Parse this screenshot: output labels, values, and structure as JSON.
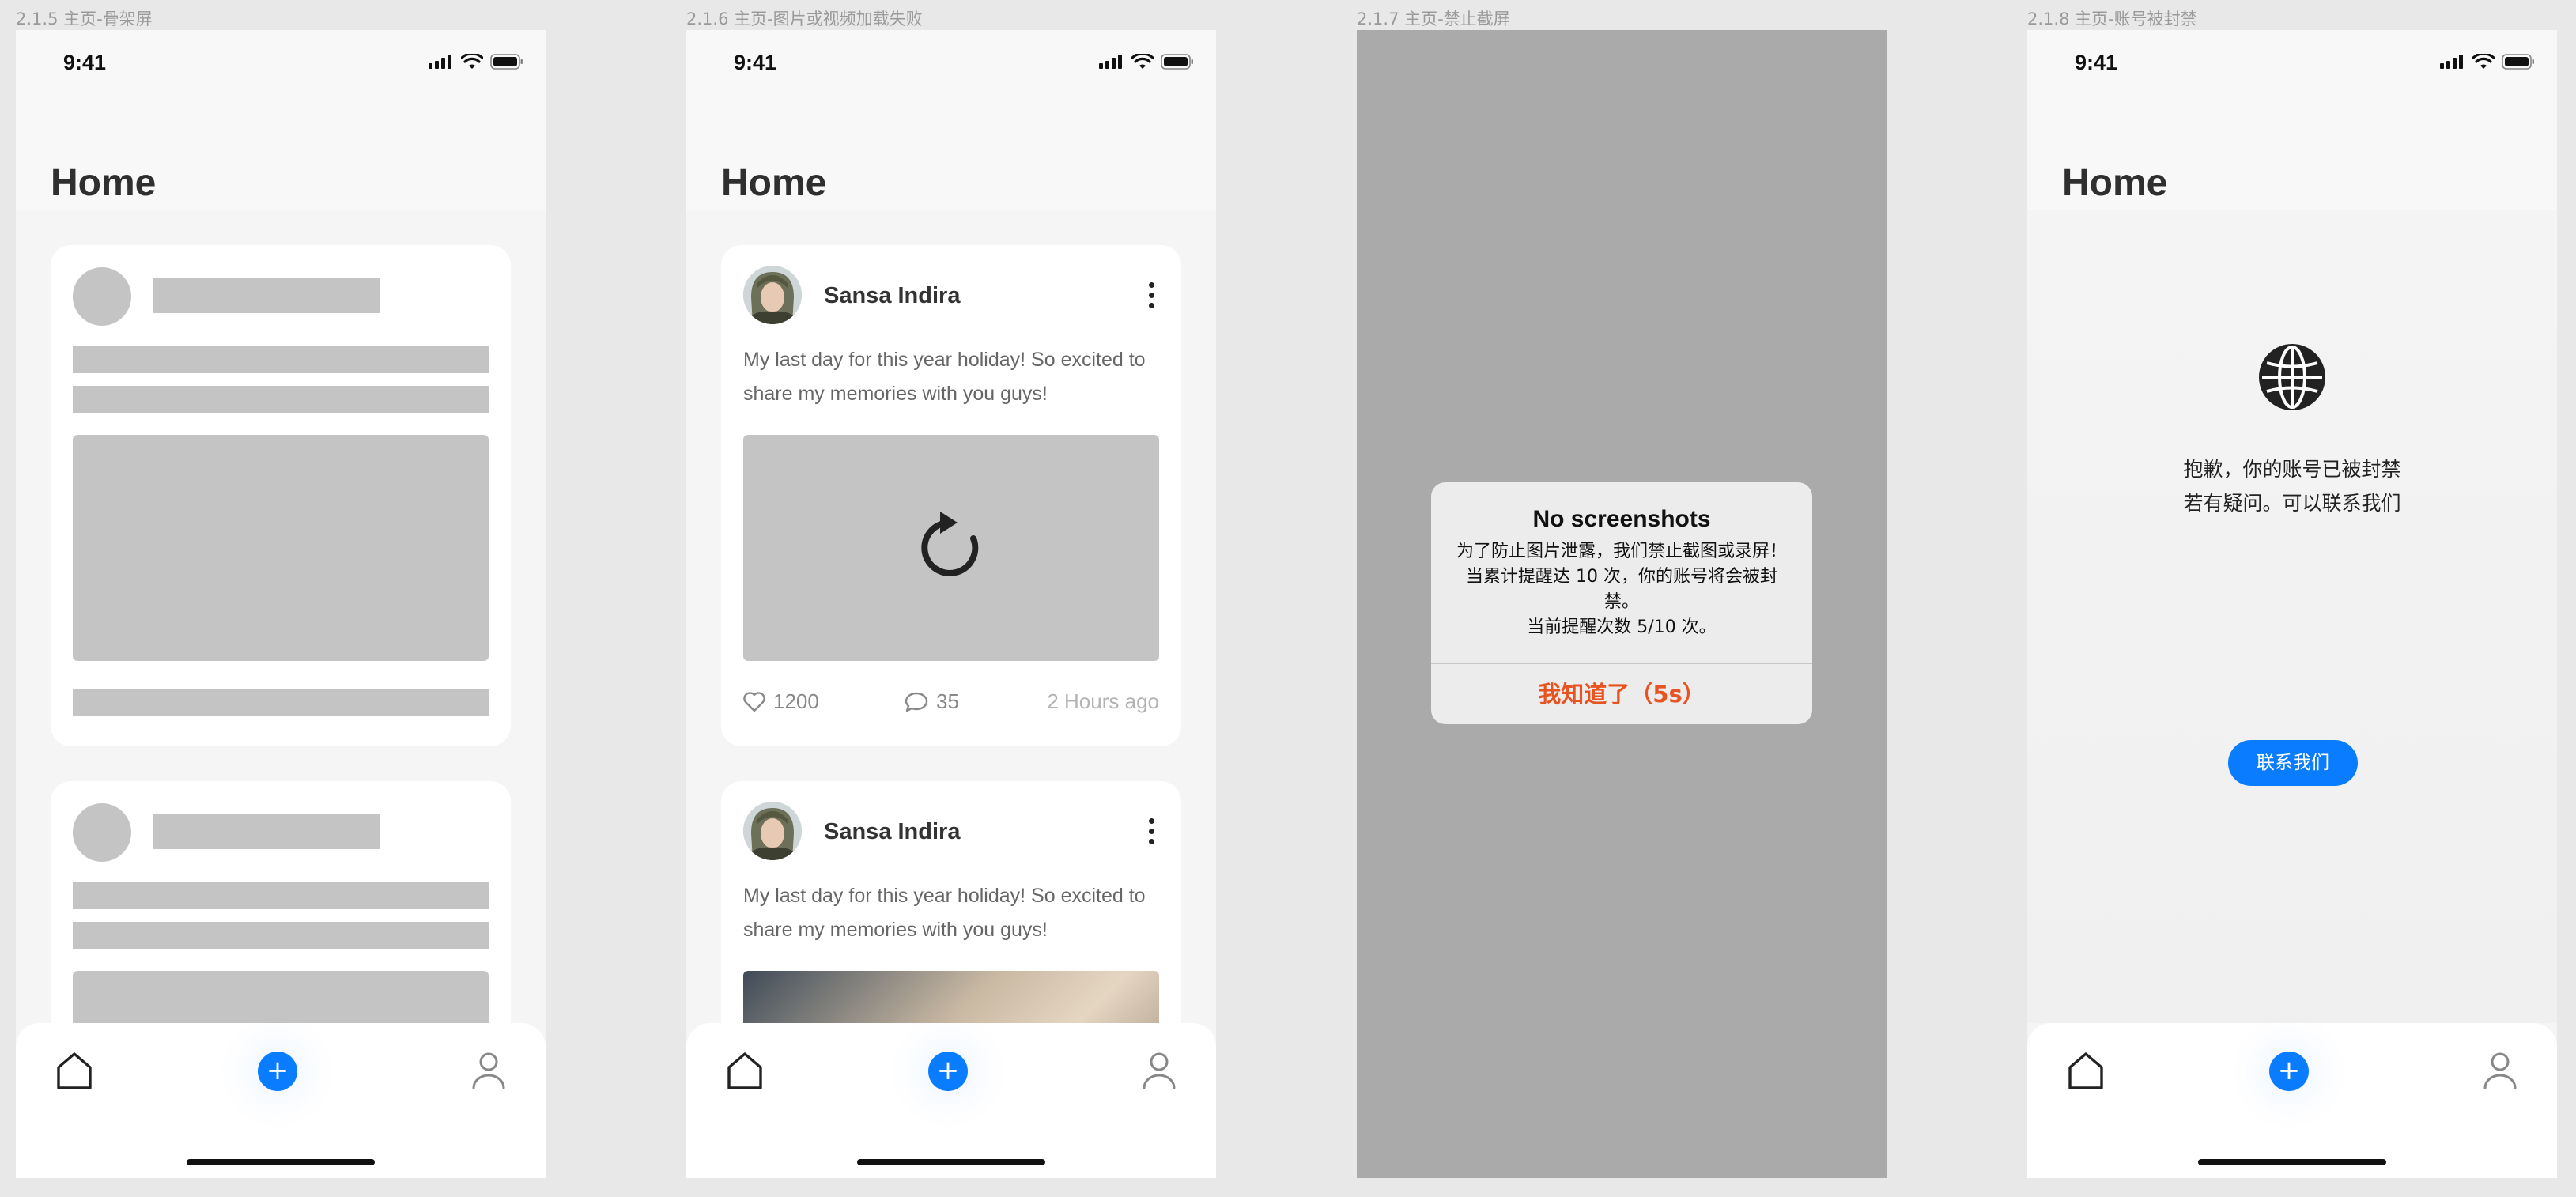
{
  "status_bar": {
    "time": "9:41"
  },
  "frames": [
    {
      "label": "2.1.5 主页-骨架屏",
      "header_title": "Home"
    },
    {
      "label": "2.1.6 主页-图片或视频加载失败",
      "header_title": "Home",
      "posts": [
        {
          "author": "Sansa Indira",
          "text": "My last day for this year holiday! So excited to share my memories with you guys!",
          "likes": "1200",
          "comments": "35",
          "time": "2 Hours ago",
          "media_state": "load-failed"
        },
        {
          "author": "Sansa Indira",
          "text": "My last day for this year holiday! So excited to share my memories with you guys!"
        }
      ]
    },
    {
      "label": "2.1.7 主页-禁止截屏",
      "alert": {
        "title": "No screenshots",
        "body_line1": "为了防止图片泄露，我们禁止截图或录屏！当累计提醒达 10 次，你的账号将会被封禁。",
        "body_line2": "当前提醒次数 5/10 次。",
        "button": "我知道了（5s）"
      }
    },
    {
      "label": "2.1.8 主页-账号被封禁",
      "header_title": "Home",
      "ban_message_line1": "抱歉，你的账号已被封禁",
      "ban_message_line2": "若有疑问。可以联系我们",
      "contact_button": "联系我们"
    }
  ],
  "tabbar": {
    "add_glyph": "+",
    "icons": [
      "home-icon",
      "add-icon",
      "user-icon"
    ]
  },
  "colors": {
    "accent": "#0a7cff",
    "alert_button": "#e85421",
    "skeleton": "#c4c4c4",
    "screen_bg": "#f5f5f5",
    "canvas_bg": "#e8e8e8",
    "overlay": "#aaaaaa"
  }
}
